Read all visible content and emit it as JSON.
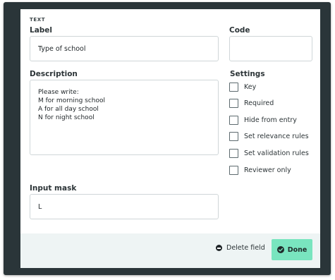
{
  "form": {
    "type_label": "TEXT",
    "label_heading": "Label",
    "label_value": "Type of school",
    "code_heading": "Code",
    "code_value": "",
    "description_heading": "Description",
    "description_lines": [
      "Please write:",
      "M for morning school",
      "A for all day school",
      "N for night school"
    ],
    "settings_heading": "Settings",
    "settings": [
      {
        "label": "Key",
        "checked": false
      },
      {
        "label": "Required",
        "checked": false
      },
      {
        "label": "Hide from entry",
        "checked": false
      },
      {
        "label": "Set relevance rules",
        "checked": false
      },
      {
        "label": "Set validation rules",
        "checked": false
      },
      {
        "label": "Reviewer only",
        "checked": false
      }
    ],
    "input_mask_heading": "Input mask",
    "input_mask_value": "L"
  },
  "footer": {
    "delete_label": "Delete field",
    "done_label": "Done"
  },
  "colors": {
    "frame": "#2a3539",
    "footer_bg": "#eef4f4",
    "done_button": "#79e5bf"
  }
}
